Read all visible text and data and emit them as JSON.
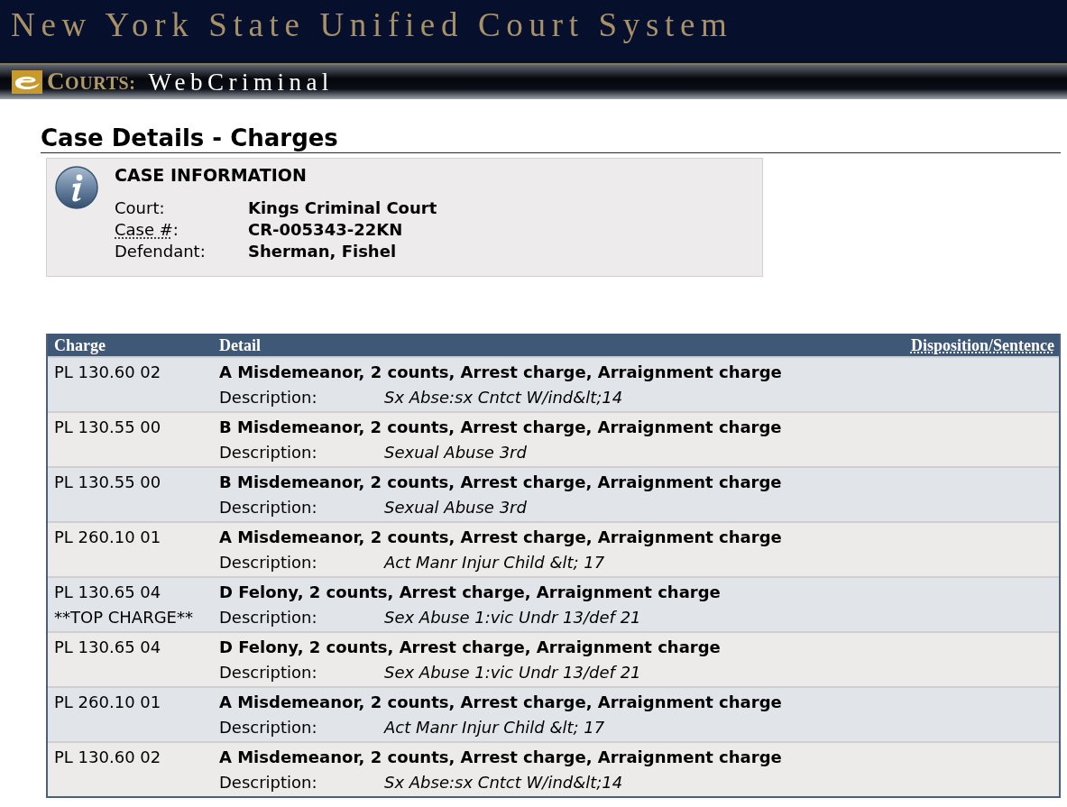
{
  "header": {
    "title": "New York State Unified Court System"
  },
  "app_bar": {
    "brand": "COURTS:",
    "app_name": "WebCriminal"
  },
  "page_title": "Case Details - Charges",
  "case_information": {
    "heading": "CASE INFORMATION",
    "fields": [
      {
        "label": "Court:",
        "abbreviated": false,
        "value": "Kings Criminal Court"
      },
      {
        "label": "Case #",
        "abbreviated": true,
        "suffix": ":",
        "value": "CR-005343-22KN"
      },
      {
        "label": "Defendant:",
        "abbreviated": false,
        "value": "Sherman, Fishel"
      }
    ]
  },
  "charges_table": {
    "columns": [
      {
        "label": "Charge",
        "abbreviated": false
      },
      {
        "label": "Detail",
        "abbreviated": false
      },
      {
        "label": "Disposition/Sentence",
        "abbreviated": true
      }
    ],
    "rows": [
      {
        "charge": "PL 130.60 02",
        "detail": "A Misdemeanor, 2 counts, Arrest charge, Arraignment charge",
        "description_label": "Description:",
        "description": "Sx Abse:sx Cntct W/ind&lt;14"
      },
      {
        "charge": "PL 130.55 00",
        "detail": "B Misdemeanor, 2 counts, Arrest charge, Arraignment charge",
        "description_label": "Description:",
        "description": "Sexual Abuse 3rd"
      },
      {
        "charge": "PL 130.55 00",
        "detail": "B Misdemeanor, 2 counts, Arrest charge, Arraignment charge",
        "description_label": "Description:",
        "description": "Sexual Abuse 3rd"
      },
      {
        "charge": "PL 260.10 01",
        "detail": "A Misdemeanor, 2 counts, Arrest charge, Arraignment charge",
        "description_label": "Description:",
        "description": "Act Manr Injur Child &lt; 17"
      },
      {
        "charge": "PL 130.65 04",
        "flag": "**TOP CHARGE**",
        "detail": "D Felony, 2 counts, Arrest charge, Arraignment charge",
        "description_label": "Description:",
        "description": "Sex Abuse 1:vic Undr 13/def 21"
      },
      {
        "charge": "PL 130.65 04",
        "detail": "D Felony, 2 counts, Arrest charge, Arraignment charge",
        "description_label": "Description:",
        "description": "Sex Abuse 1:vic Undr 13/def 21"
      },
      {
        "charge": "PL 260.10 01",
        "detail": "A Misdemeanor, 2 counts, Arrest charge, Arraignment charge",
        "description_label": "Description:",
        "description": "Act Manr Injur Child &lt; 17"
      },
      {
        "charge": "PL 130.60 02",
        "detail": "A Misdemeanor, 2 counts, Arrest charge, Arraignment charge",
        "description_label": "Description:",
        "description": "Sx Abse:sx Cntct W/ind&lt;14"
      }
    ]
  }
}
